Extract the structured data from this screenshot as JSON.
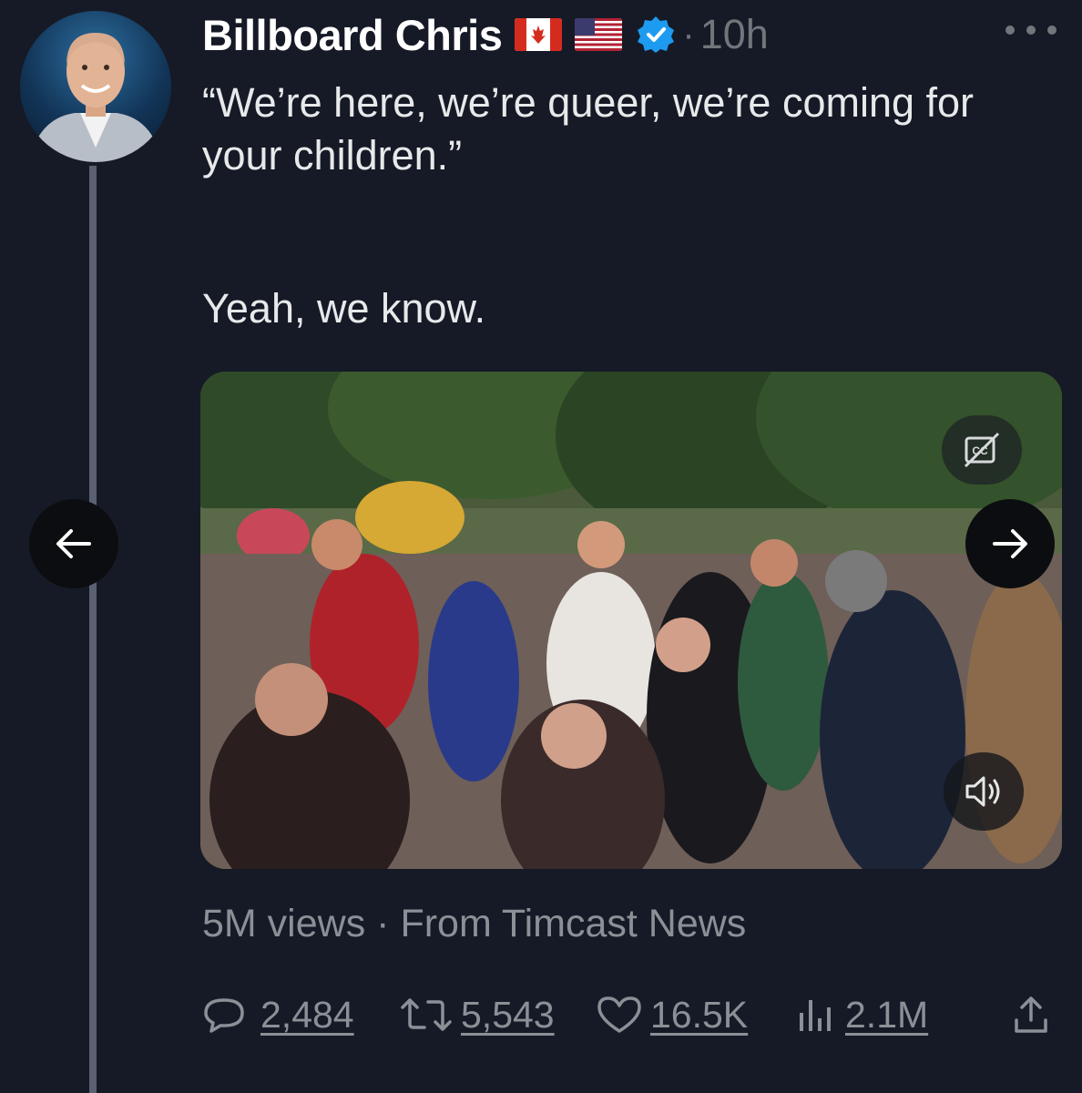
{
  "tweet": {
    "author_name": "Billboard Chris",
    "flags": [
      "canada-flag",
      "usa-flag"
    ],
    "verified": true,
    "separator": "·",
    "time_ago": "10h",
    "text_line1": "“We’re here, we’re queer, we’re coming for your children.”",
    "text_line2": "Yeah, we know."
  },
  "media": {
    "views": "5M views",
    "dot": "·",
    "source": "From Timcast News",
    "controls": [
      "closed-captions-icon",
      "volume-icon"
    ]
  },
  "navigation": {
    "prev_icon": "arrow-left-icon",
    "next_icon": "arrow-right-icon"
  },
  "actions": {
    "replies": "2,484",
    "retweets": "5,543",
    "likes": "16.5K",
    "views": "2.1M"
  },
  "colors": {
    "background": "#161a26",
    "text_primary": "#e7e9ea",
    "text_secondary": "#71767b",
    "verified": "#1d9bf0"
  }
}
